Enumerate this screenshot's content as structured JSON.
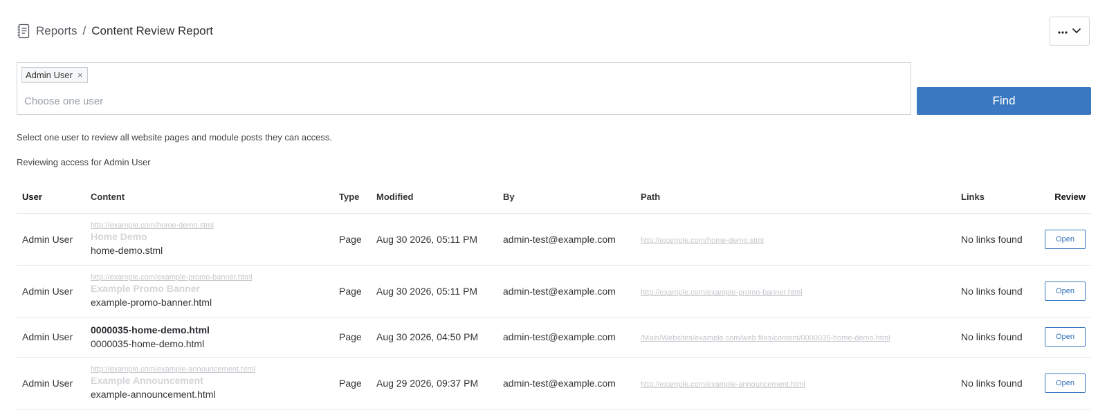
{
  "breadcrumb": {
    "parent": "Reports",
    "separator": "/",
    "title": "Content Review Report"
  },
  "toolbar": {
    "more_icon": "more-dots-icon",
    "chevron_icon": "chevron-down-icon"
  },
  "user_select": {
    "selected_chip": "Admin User",
    "chip_remove": "×",
    "placeholder": "Choose one user",
    "value": ""
  },
  "find_button": {
    "label": "Find",
    "color": "#3a78c2"
  },
  "helper_text": "Select one user to review all website pages and module posts they can access.",
  "reviewing_text": "Reviewing access for Admin User",
  "table": {
    "headers": [
      "User",
      "Content",
      "Type",
      "Modified",
      "By",
      "Path",
      "Links",
      "Review"
    ],
    "rows": [
      {
        "user": "Admin User",
        "content_url": "http://example.com/home-demo.stml",
        "content_title": "Home Demo",
        "content_file": "home-demo.stml",
        "type": "Page",
        "modified": "Aug 30 2026, 05:11 PM",
        "by": "admin-test@example.com",
        "path": "http://example.com/home-demo.stml",
        "links": "No links found",
        "review": "Open"
      },
      {
        "user": "Admin User",
        "content_url": "http://example.com/example-promo-banner.html",
        "content_title": "Example Promo Banner",
        "content_file": "example-promo-banner.html",
        "type": "Page",
        "modified": "Aug 30 2026, 05:11 PM",
        "by": "admin-test@example.com",
        "path": "http://example.com/example-promo-banner.html",
        "links": "No links found",
        "review": "Open"
      },
      {
        "user": "Admin User",
        "content_url": "",
        "content_title": "0000035-home-demo.html",
        "content_file": "0000035-home-demo.html",
        "type": "Page",
        "modified": "Aug 30 2026, 04:50 PM",
        "by": "admin-test@example.com",
        "path": "/Main/Websites/example.com/web files/content/0000035-home-demo.html",
        "links": "No links found",
        "review": "Open"
      },
      {
        "user": "Admin User",
        "content_url": "http://example.com/example-announcement.html",
        "content_title": "Example Announcement",
        "content_file": "example-announcement.html",
        "type": "Page",
        "modified": "Aug 29 2026, 09:37 PM",
        "by": "admin-test@example.com",
        "path": "http://example.com/example-announcement.html",
        "links": "No links found",
        "review": "Open"
      }
    ]
  }
}
